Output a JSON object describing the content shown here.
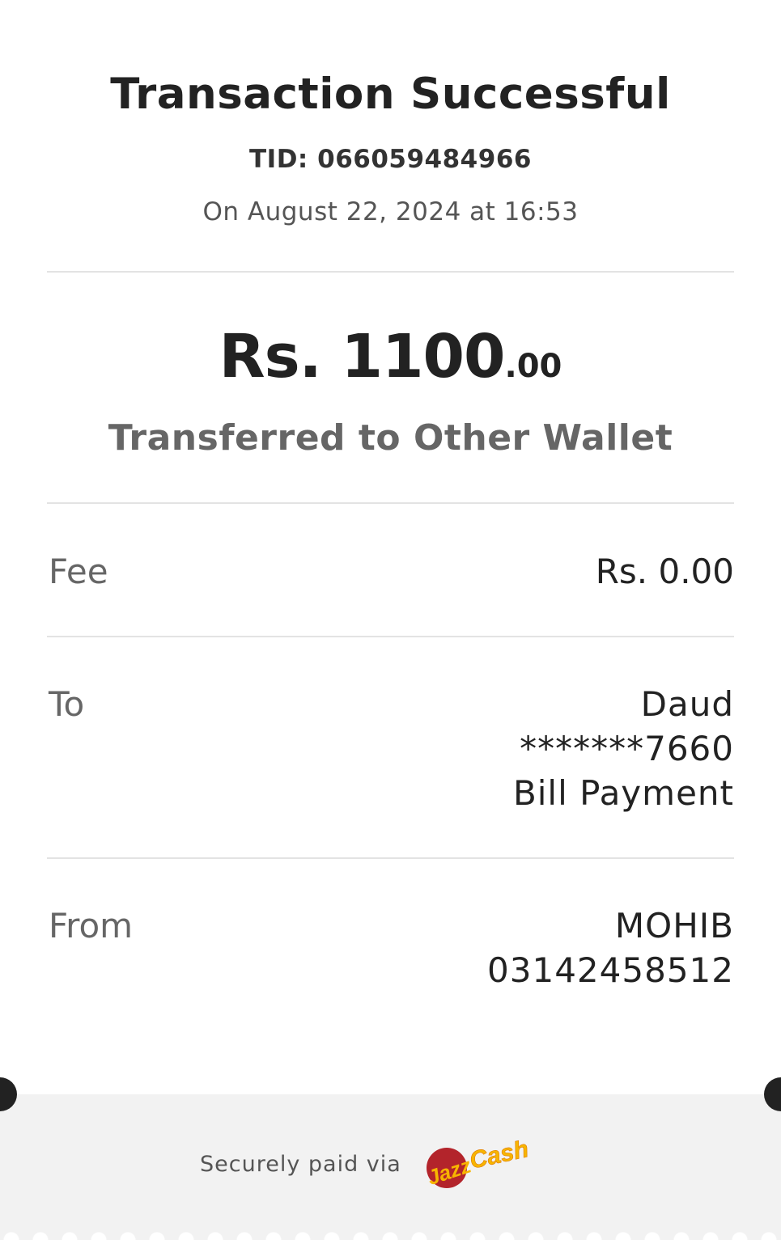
{
  "header": {
    "title": "Transaction Successful",
    "tid_label": "TID:",
    "tid_value": "066059484966",
    "datetime": "On August 22, 2024 at 16:53"
  },
  "amount": {
    "main": "Rs. 1100",
    "decimals": ".00",
    "description": "Transferred to Other Wallet"
  },
  "details": {
    "fee": {
      "label": "Fee",
      "value": "Rs. 0.00"
    },
    "to": {
      "label": "To",
      "name": "Daud",
      "account": "*******7660",
      "purpose": "Bill Payment"
    },
    "from": {
      "label": "From",
      "name": "MOHIB",
      "account": "03142458512"
    }
  },
  "footer": {
    "secure_text": "Securely paid via",
    "logo_text_jazz": "Jazz",
    "logo_text_cash": "Cash"
  },
  "colors": {
    "title": "#222222",
    "muted": "#666666",
    "divider": "#e3e3e3",
    "footer_bg": "#f2f2f2",
    "jazz_red": "#b3242b",
    "cash_yellow": "#f7b500"
  }
}
